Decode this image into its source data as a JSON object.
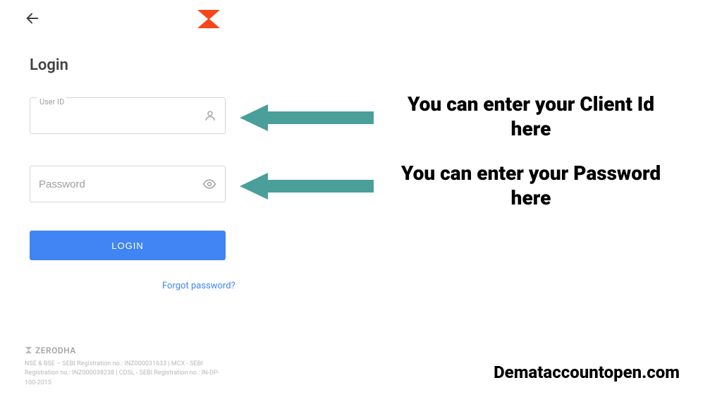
{
  "header": {
    "heading": "Login"
  },
  "inputs": {
    "userid_label": "User ID",
    "userid_placeholder": "",
    "password_placeholder": "Password"
  },
  "actions": {
    "login_label": "LOGIN",
    "forgot_label": "Forgot password?"
  },
  "footer": {
    "brand": "ZERODHA",
    "reg_text": "NSE & BSE – SEBI Registration no.: INZ000031633 | MCX - SEBI Registration no.: INZ000038238 | CDSL - SEBI Registration no.: IN-DP-100-2015"
  },
  "annotations": {
    "line1": "You can enter your Client Id here",
    "line2": "You can enter your Password here",
    "watermark": "Demataccountopen.com"
  }
}
